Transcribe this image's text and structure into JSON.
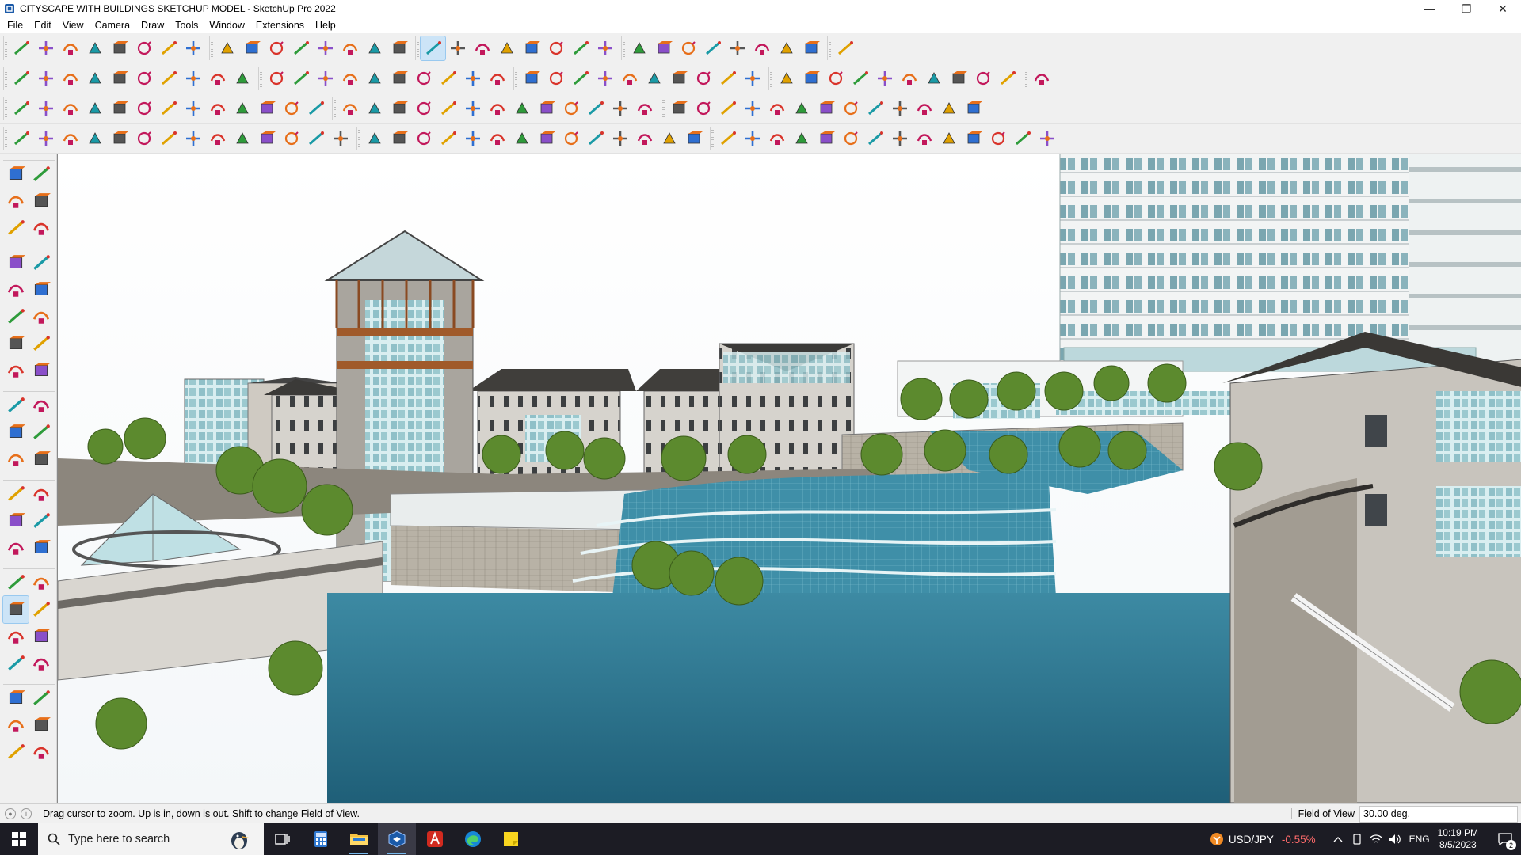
{
  "window": {
    "title": "CITYSCAPE WITH BUILDINGS SKETCHUP MODEL - SketchUp Pro 2022",
    "controls": {
      "minimize": "—",
      "restore": "❐",
      "close": "✕"
    }
  },
  "menu": [
    "File",
    "Edit",
    "View",
    "Camera",
    "Draw",
    "Tools",
    "Window",
    "Extensions",
    "Help"
  ],
  "toolbars": {
    "row1": [
      "zoom",
      "select",
      "eraser",
      "line",
      "freehand",
      "rectangle",
      "push-pull",
      "follow-me",
      "move",
      "rotate",
      "scale",
      "tape",
      "text",
      "paint",
      "orbit",
      "pan",
      "zoom-active",
      "zoom-extents",
      "layers",
      "section",
      "shadows",
      "fog",
      "styles",
      "warehouse",
      "extension",
      "components",
      "outliner",
      "up-down",
      "grab",
      "hide",
      "undo",
      "redo",
      "stop"
    ],
    "row2": [
      "solid-box",
      "shaded-box",
      "xray-box",
      "pushpull-red",
      "pushpull-blue",
      "pushpull-green",
      "pushpull-orange",
      "pushpull-yellow",
      "pushpull-magenta",
      "curve",
      "slash1",
      "slash2",
      "slash3",
      "face-green",
      "face-add",
      "house1",
      "house2",
      "house3",
      "house4",
      "house5",
      "house6",
      "formula",
      "curve2",
      "knife",
      "shape1",
      "shape2",
      "shape3",
      "shape4",
      "shape5",
      "shape6",
      "shape7",
      "shape8",
      "shape9",
      "shape10",
      "tool1",
      "tool2",
      "tool3",
      "tool4",
      "tool5",
      "tool6",
      "tool7"
    ],
    "row3": [
      "plane-blue1",
      "plane-blue2",
      "plane-yellow",
      "plane-green",
      "plane-red",
      "plane-white",
      "rotate-orange",
      "red-square",
      "grid-lines",
      "scroll",
      "cube-wood",
      "link",
      "corner",
      "dots-curve",
      "plus-red",
      "plus-green",
      "cross-blue",
      "cone-teal",
      "fountain",
      "warning",
      "hook1",
      "hook2",
      "spiral",
      "move-dots",
      "bucket",
      "magnet",
      "leaf",
      "copy1",
      "copy2",
      "copy3",
      "gem",
      "flower",
      "frame",
      "hatch1",
      "hatch2",
      "hatch3",
      "scatter",
      "arc-dots",
      "grid-small"
    ],
    "row4": [
      "draw1",
      "draw2",
      "draw3",
      "draw4",
      "draw5",
      "draw6",
      "draw7",
      "draw8",
      "draw9",
      "draw10",
      "draw11",
      "draw12",
      "draw13",
      "draw14",
      "draw15",
      "draw16",
      "draw17",
      "draw18",
      "draw19",
      "draw20",
      "draw21",
      "draw22",
      "draw23",
      "draw24",
      "draw25",
      "draw26",
      "draw27",
      "draw28",
      "draw29",
      "draw30",
      "draw31",
      "draw32",
      "draw33",
      "draw34",
      "draw35",
      "draw36",
      "draw37",
      "draw38",
      "draw39",
      "draw40",
      "draw41",
      "draw42"
    ]
  },
  "palette": [
    "select",
    "orbit",
    "paint",
    "eraser",
    "components",
    "tag-pen",
    "line",
    "freehand",
    "rectangle",
    "rotated-rect",
    "circle",
    "polygon",
    "arc",
    "pie",
    "arc2",
    "arc3",
    "move",
    "push-pull",
    "rotate",
    "follow-me",
    "scale",
    "offset",
    "tape",
    "dimension",
    "protractor",
    "text",
    "axes",
    "3d-text",
    "orbit2",
    "pan",
    "zoom",
    "zoom-window",
    "zoom-extents",
    "previous",
    "position-camera",
    "look-around",
    "walk",
    "section",
    "layers1",
    "layers2",
    "layers3",
    "layers4"
  ],
  "status": {
    "message": "Drag cursor to zoom.  Up is in, down is out. Shift to change Field of View.",
    "vcb_label": "Field of View",
    "vcb_value": "30.00 deg."
  },
  "taskbar": {
    "search_placeholder": "Type here to search",
    "ticker_symbol": "USD/JPY",
    "ticker_change": "-0.55%",
    "language": "ENG",
    "time": "10:19 PM",
    "date": "8/5/2023",
    "notification_count": "2"
  },
  "colors": {
    "toolbar_bg": "#f0f0f0",
    "taskbar_bg": "#1c1c24",
    "sky": "#ffffff",
    "water": "#2f7f9a",
    "ticker_negative": "#ff6b6b",
    "active_tool": "#cce4f7"
  }
}
